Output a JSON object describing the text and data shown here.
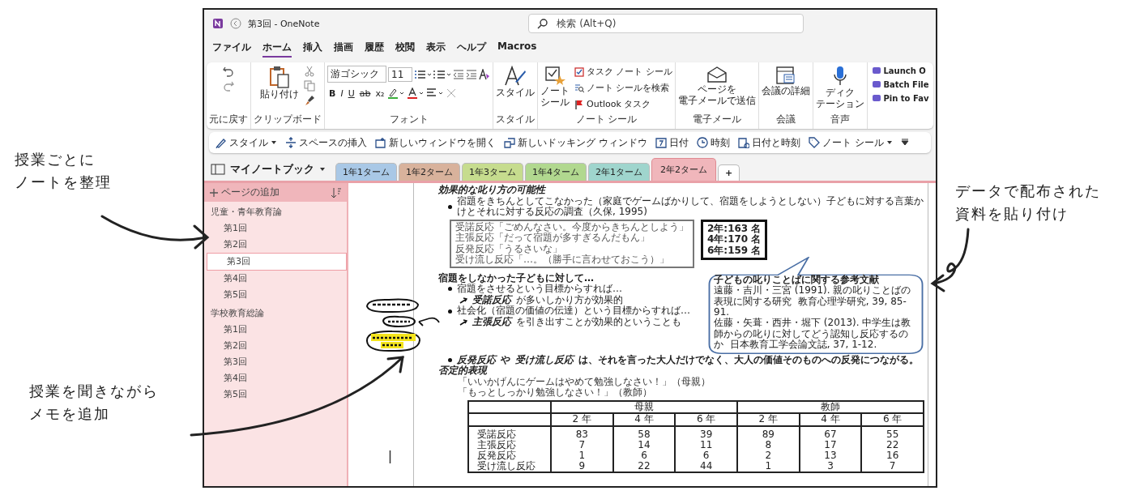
{
  "annotations": {
    "left": [
      [
        "授業ごとに",
        "ノートを整理"
      ],
      [
        "授業を聞きながら",
        "メモを追加"
      ]
    ],
    "right": [
      "データで配布された",
      "資料を貼り付け"
    ]
  },
  "window": {
    "title": "第3回 - OneNote",
    "search": {
      "placeholder": "検索 (Alt+Q)"
    }
  },
  "menu": [
    {
      "label": "ファイル",
      "selected": false
    },
    {
      "label": "ホーム",
      "selected": true
    },
    {
      "label": "挿入",
      "selected": false
    },
    {
      "label": "描画",
      "selected": false
    },
    {
      "label": "履歴",
      "selected": false
    },
    {
      "label": "校閲",
      "selected": false
    },
    {
      "label": "表示",
      "selected": false
    },
    {
      "label": "ヘルプ",
      "selected": false
    },
    {
      "label": "Macros",
      "selected": false
    }
  ],
  "ribbon": {
    "undo": {
      "label": "元に戻す"
    },
    "clipboard": {
      "paste": "貼り付け",
      "label": "クリップボード"
    },
    "font": {
      "family": "游ゴシック",
      "size": "11",
      "format": [
        "B",
        "I",
        "U",
        "ab",
        "x₂"
      ],
      "label": "フォント"
    },
    "style": {
      "button": "スタイル",
      "label": "スタイル"
    },
    "tags": {
      "button": [
        "ノート",
        "シール"
      ],
      "items": [
        "タスク ノート シール",
        "ノート シールを検索",
        "Outlook タスク"
      ],
      "label": "ノート シール"
    },
    "email": {
      "button": [
        "ページを",
        "電子メールで送信"
      ],
      "label": "電子メール"
    },
    "meeting": {
      "button": "会議の詳細",
      "label": "会議"
    },
    "voice": {
      "button": [
        "ディク",
        "テーション"
      ],
      "label": "音声"
    },
    "addins": [
      "Launch O",
      "Batch File",
      "Pin to Fav"
    ]
  },
  "quick_toolbar": [
    "スタイル",
    "スペースの挿入",
    "新しいウィンドウを開く",
    "新しいドッキング ウィンドウ",
    "日付",
    "時刻",
    "日付と時刻",
    "ノート シール"
  ],
  "notebook": {
    "name": "マイノートブック",
    "tabs": [
      {
        "label": "1年1ターム",
        "selected": false,
        "color": "#a9c8e6"
      },
      {
        "label": "1年2ターム",
        "selected": false,
        "color": "#d8b29c"
      },
      {
        "label": "1年3ターム",
        "selected": false,
        "color": "#c6dc8e"
      },
      {
        "label": "1年4ターム",
        "selected": false,
        "color": "#b1d88f"
      },
      {
        "label": "2年1ターム",
        "selected": false,
        "color": "#9fd5cd"
      },
      {
        "label": "2年2ターム",
        "selected": true,
        "color": "#f0b6bb"
      }
    ],
    "add_tab": "+"
  },
  "sidebar": {
    "add_page": "ページの追加",
    "sections": [
      {
        "title": "児童・青年教育論",
        "children": [
          {
            "title": "第1回",
            "selected": false
          },
          {
            "title": "第2回",
            "selected": false
          },
          {
            "title": "第3回",
            "selected": true
          },
          {
            "title": "第4回",
            "selected": false
          },
          {
            "title": "第5回",
            "selected": false
          }
        ]
      },
      {
        "title": "学校教育総論",
        "children": [
          {
            "title": "第1回",
            "selected": false
          },
          {
            "title": "第2回",
            "selected": false
          },
          {
            "title": "第3回",
            "selected": false
          },
          {
            "title": "第4回",
            "selected": false
          },
          {
            "title": "第5回",
            "selected": false
          }
        ]
      }
    ]
  },
  "page": {
    "heading": "効果的な叱り方の可能性",
    "intro": "宿題をきちんとしてこなかった（家庭でゲームばかりして、宿題をしようとしない）子どもに対する言葉かけとそれに対する反応の調査（久保, 1995)",
    "responses": [
      "受諾反応「ごめんなさい。今度からきちんとしよう」",
      "主張反応「だって宿題が多すぎるんだもん」",
      "反発反応「うるさいな」",
      "受け流し反応「…。（勝手に言わせておこう）」"
    ],
    "counts": [
      "2年:163 名",
      "4年:170 名",
      "6年:159 名"
    ],
    "subheading": "宿題をしなかった子どもに対して…",
    "bullets": [
      {
        "kind": "bullet",
        "text": "宿題をさせるという目標からすれば…"
      },
      {
        "kind": "sub",
        "mark": "受諾反応",
        "text": "が多いしかり方が効果的"
      },
      {
        "kind": "bullet",
        "text": "社会化（宿題の価値の伝達）という目標からすれば…"
      },
      {
        "kind": "sub",
        "mark": "主張反応",
        "text": "を引き出すことが効果的ということも"
      }
    ],
    "last_bullet": {
      "mark1": "反発反応",
      "mid": "や",
      "mark2": "受け流し反応",
      "text": "は、それを言った大人だけでなく、大人の価値そのものへの反発につながる。"
    },
    "references": {
      "title": "子どもの叱りことばに関する参考文献",
      "items": [
        "遠藤・吉川・三宮 (1991). 親の叱りことばの表現に関する研究  教育心理学研究, 39, 85-91.",
        "佐藤・矢葺・西井・堀下 (2013). 中学生は教師からの叱りに対してどう認知し反応するのか  日本教育工学会論文誌, 37, 1-12."
      ]
    },
    "heading2": "否定的表現",
    "quotes": [
      "「いいかげんにゲームはやめて勉強しなさい！」（母親）",
      "「もっとしっかり勉強しなさい！」（教師）"
    ],
    "table": {
      "groups": [
        "母親",
        "教師"
      ],
      "years": [
        "2 年",
        "4 年",
        "6 年",
        "2 年",
        "4 年",
        "6 年"
      ],
      "rows": [
        {
          "label": "受諾反応",
          "values": [
            "83",
            "58",
            "39",
            "89",
            "67",
            "55"
          ]
        },
        {
          "label": "主張反応",
          "values": [
            "7",
            "14",
            "11",
            "8",
            "17",
            "22"
          ]
        },
        {
          "label": "反発反応",
          "values": [
            "1",
            "6",
            "6",
            "2",
            "13",
            "16"
          ]
        },
        {
          "label": "受け流し反応",
          "values": [
            "9",
            "22",
            "44",
            "1",
            "3",
            "7"
          ]
        }
      ]
    }
  }
}
